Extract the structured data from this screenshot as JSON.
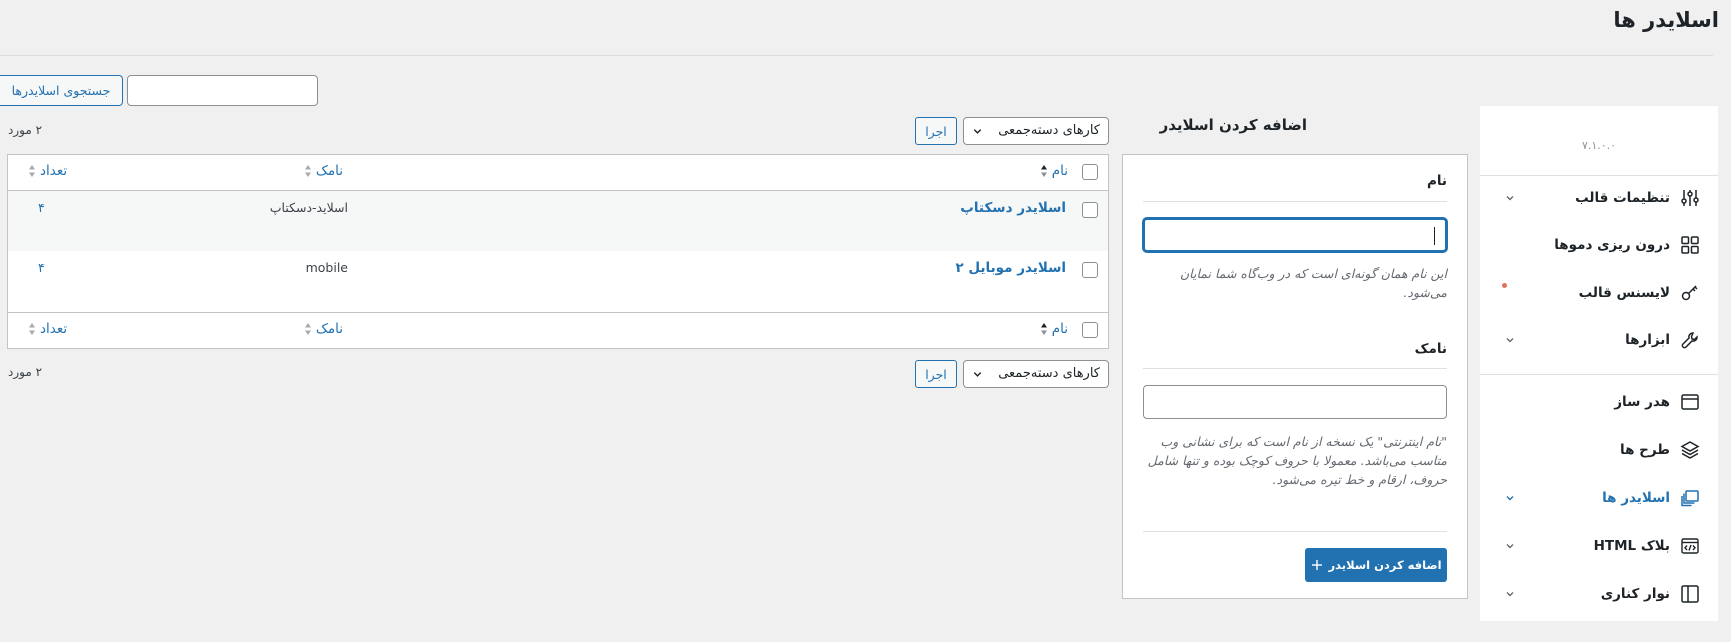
{
  "page": {
    "title": "اسلایدر ها"
  },
  "search": {
    "button_label": "جستجوی اسلایدرها",
    "value": ""
  },
  "sidebar": {
    "version": "۷.۱.۰.۰",
    "items": [
      {
        "label": "تنظیمات قالب",
        "icon": "sliders-icon",
        "chevron": true
      },
      {
        "label": "درون ریزی دموها",
        "icon": "grid-icon",
        "chevron": false
      },
      {
        "label": "لایسنس قالب",
        "icon": "key-icon",
        "chevron": false,
        "dot": true
      },
      {
        "label": "ابزارها",
        "icon": "wrench-icon",
        "chevron": true
      },
      {
        "label": "هدر ساز",
        "icon": "window-icon",
        "chevron": false
      },
      {
        "label": "طرح ها",
        "icon": "layers-icon",
        "chevron": false
      },
      {
        "label": "اسلایدر ها",
        "icon": "slides-icon",
        "chevron": true,
        "active": true
      },
      {
        "label": "بلاک HTML",
        "icon": "code-icon",
        "chevron": true
      },
      {
        "label": "نوار کناری",
        "icon": "sidebar-icon",
        "chevron": true
      }
    ],
    "accent": "#2271b1"
  },
  "form": {
    "heading": "اضافه کردن اسلایدر",
    "name_label": "نام",
    "name_value": "",
    "name_help": "این نام همان گونه‌ای است که در وب‌گاه شما نمایان می‌شود.",
    "slug_label": "نامک",
    "slug_value": "",
    "slug_help": "\"نام اینترنتی\" یک نسخه از نام است که برای نشانی وب متاسب می‌باشد. معمولا با حروف کوچک بوده و تنها شامل حروف، ارقام و خط تیره می‌شود.",
    "submit_label": "اضافه کردن اسلایدر"
  },
  "bulk": {
    "select_label": "کارهای دسته‌جمعی",
    "apply_label": "اجرا",
    "count_label": "۲ مورد"
  },
  "table": {
    "columns": {
      "name": "نام",
      "slug": "نامک",
      "count": "تعداد"
    },
    "rows": [
      {
        "name": "اسلایدر دسکتاپ",
        "slug": "اسلاید-دسکتاپ",
        "count": "۴"
      },
      {
        "name": "اسلایدر موبایل ۲",
        "slug": "mobile",
        "count": "۴"
      }
    ]
  }
}
